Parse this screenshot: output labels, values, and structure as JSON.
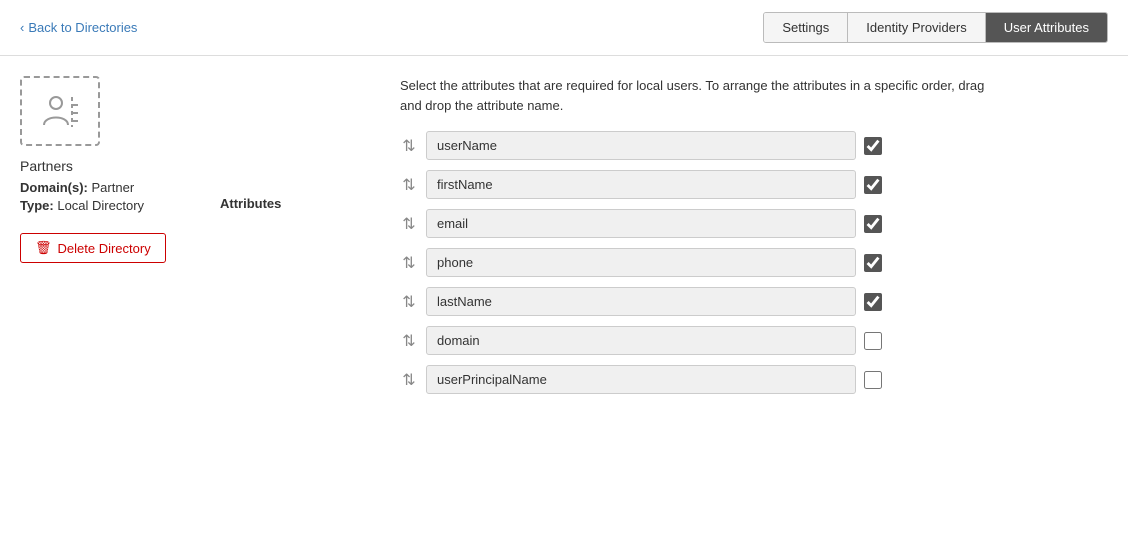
{
  "header": {
    "back_label": "Back to Directories",
    "tabs": [
      {
        "id": "settings",
        "label": "Settings",
        "active": false
      },
      {
        "id": "identity-providers",
        "label": "Identity Providers",
        "active": false
      },
      {
        "id": "user-attributes",
        "label": "User Attributes",
        "active": true
      }
    ]
  },
  "sidebar": {
    "directory_name": "Partners",
    "domains_label": "Domain(s):",
    "domains_value": "Partner",
    "type_label": "Type:",
    "type_value": "Local Directory",
    "delete_label": "Delete Directory"
  },
  "attributes_section": {
    "label": "Attributes",
    "description": "Select the attributes that are required for local users. To arrange the attributes in a specific order, drag and drop the attribute name.",
    "items": [
      {
        "name": "userName",
        "checked": true,
        "disabled": true
      },
      {
        "name": "firstName",
        "checked": true,
        "disabled": false
      },
      {
        "name": "email",
        "checked": true,
        "disabled": false
      },
      {
        "name": "phone",
        "checked": true,
        "disabled": false
      },
      {
        "name": "lastName",
        "checked": true,
        "disabled": false
      },
      {
        "name": "domain",
        "checked": false,
        "disabled": false
      },
      {
        "name": "userPrincipalName",
        "checked": false,
        "disabled": false
      }
    ]
  },
  "icons": {
    "chevron_left": "‹",
    "drag_handle": "⇅",
    "trash": "🗑"
  }
}
